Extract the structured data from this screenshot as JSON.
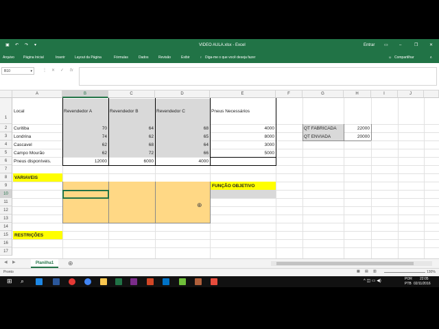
{
  "titlebar": {
    "doc_title": "VIDEO AULA.xlsx - Excel",
    "signin": "Entrar"
  },
  "ribbon": {
    "tabs": [
      "Arquivo",
      "Página Inicial",
      "Inserir",
      "Layout da Página",
      "Fórmulas",
      "Dados",
      "Revisão",
      "Exibir"
    ],
    "tellme": "Diga-me o que você deseja fazer",
    "share": "Compartilhar"
  },
  "formula": {
    "namebox": "B10",
    "fx": "fx",
    "value": ""
  },
  "columns": [
    "A",
    "B",
    "C",
    "D",
    "E",
    "F",
    "G",
    "H",
    "I",
    "J"
  ],
  "rows": [
    "1",
    "2",
    "3",
    "4",
    "5",
    "6",
    "7",
    "8",
    "9",
    "10",
    "11",
    "12",
    "13",
    "14",
    "15",
    "16",
    "17"
  ],
  "cells": {
    "A1": "Local",
    "B1": "Revendedor A",
    "C1": "Revendedor B",
    "D1": "Revendedor C",
    "E1": "Pneus Necessários",
    "A2": "Curitiba",
    "B2": "70",
    "C2": "64",
    "D2": "68",
    "E2": "4000",
    "G2": "QT FABRICADA",
    "H2": "22000",
    "A3": "Londrina",
    "B3": "74",
    "C3": "62",
    "D3": "65",
    "E3": "8000",
    "G3": "QT ENVIADA",
    "H3": "20000",
    "A4": "Cascavel",
    "B4": "62",
    "C4": "68",
    "D4": "64",
    "E4": "3000",
    "A5": "Campo Mourão",
    "B5": "62",
    "C5": "72",
    "D5": "66",
    "E5": "5000",
    "A6": "Pneus disponíveis.",
    "B6": "12000",
    "C6": "6000",
    "D6": "4000",
    "A8": "VARIAVEIS",
    "E9": "FUNÇÃO OBJETIVO",
    "A15": "RESTRIÇÕES"
  },
  "sheet": {
    "tab": "Planilha1"
  },
  "status": {
    "ready": "Pronto",
    "zoom": "130%"
  },
  "taskbar": {
    "lang": "POR",
    "kbd": "PTB",
    "time": "22:05",
    "date": "02/11/2016"
  }
}
